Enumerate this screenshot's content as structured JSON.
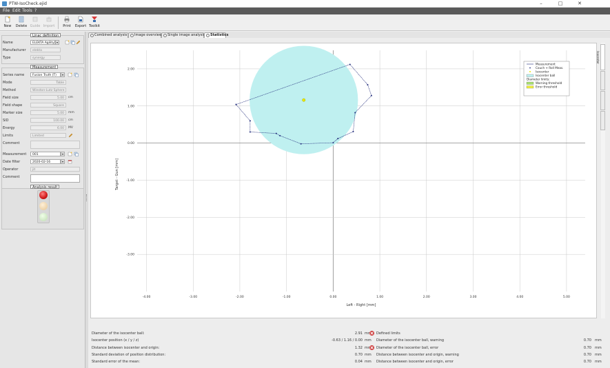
{
  "window": {
    "title": "PTW-IsoCheck.ejid"
  },
  "menu": [
    "File",
    "Edit",
    "Tools",
    "?"
  ],
  "toolbar": {
    "buttons": [
      {
        "label": "New",
        "icon": "new-file-icon",
        "enabled": true
      },
      {
        "label": "Delete",
        "icon": "delete-icon",
        "enabled": true
      },
      {
        "label": "Guide",
        "icon": "guide-icon",
        "enabled": false
      },
      {
        "label": "Import",
        "icon": "import-icon",
        "enabled": false
      },
      {
        "label": "Print",
        "icon": "print-icon",
        "enabled": true
      },
      {
        "label": "Export",
        "icon": "export-icon",
        "enabled": true
      },
      {
        "label": "Toolkit",
        "icon": "toolkit-icon",
        "enabled": true
      }
    ]
  },
  "linac": {
    "header": "Linac definition",
    "name_label": "Name",
    "name_value": "ELEKTA Agility",
    "manufacturer_label": "Manufacturer",
    "manufacturer_value": "elekta",
    "type_label": "Type",
    "type_value": "synergy"
  },
  "measurement": {
    "header": "Measurement",
    "fields": [
      {
        "label": "Series name",
        "value": "Fusion Truth (T)",
        "unit": "",
        "kind": "combo"
      },
      {
        "label": "Mode",
        "value": "Table",
        "unit": "",
        "kind": "ro"
      },
      {
        "label": "Method",
        "value": "Winston-Lutz Sphere",
        "unit": "",
        "kind": "ro"
      },
      {
        "label": "Field size",
        "value": "5.00",
        "unit": "cm",
        "kind": "ro"
      },
      {
        "label": "Field shape",
        "value": "Square",
        "unit": "",
        "kind": "ro"
      },
      {
        "label": "Marker size",
        "value": "5.00",
        "unit": "mm",
        "kind": "ro"
      },
      {
        "label": "SID",
        "value": "100.00",
        "unit": "cm",
        "kind": "ro"
      },
      {
        "label": "Energy",
        "value": "6.00",
        "unit": "MV",
        "kind": "ro"
      },
      {
        "label": "Limits",
        "value": "Limited",
        "unit": "",
        "kind": "ro"
      },
      {
        "label": "Comment",
        "value": "",
        "unit": "",
        "kind": "ro"
      }
    ],
    "measurement_label": "Measurement",
    "measurement_value": "001",
    "date_label": "Date filter",
    "date_value": "2020-02-16",
    "operator_label": "Operator",
    "operator_value": "jit",
    "comment_label": "Comment",
    "comment_value": ""
  },
  "analysis": {
    "header": "Analysis result"
  },
  "tabs": [
    {
      "label": "Combined analysis",
      "active": false
    },
    {
      "label": "Image overview",
      "active": false
    },
    {
      "label": "Single image analysis",
      "active": false
    },
    {
      "label": "Statistics",
      "active": true
    }
  ],
  "side_tabs": [
    "Isocenter",
    "",
    "",
    ""
  ],
  "chart_data": {
    "type": "scatter",
    "xlabel": "Left - Right [mm]",
    "ylabel": "Target - Gun [mm]",
    "xlim": [
      -4.2,
      5.4
    ],
    "ylim": [
      -4.0,
      2.5
    ],
    "xticks": [
      -4,
      -3,
      -2,
      -1,
      0,
      1,
      2,
      3,
      4,
      5
    ],
    "yticks": [
      2,
      1,
      0,
      -1,
      -2,
      -3
    ],
    "xtick_labels": [
      "-4.00",
      "-3.00",
      "-2.00",
      "-1.00",
      "0.00",
      "1.00",
      "2.00",
      "3.00",
      "4.00",
      "5.00"
    ],
    "ytick_labels": [
      "2.00",
      "1.00",
      "0.00",
      "-1.00",
      "-2.00",
      "-3.00"
    ],
    "grid": true,
    "legend_position": "top-right",
    "isocenter_ball": {
      "center": [
        -0.63,
        1.16
      ],
      "radius": 1.46,
      "color": "#bff0f0"
    },
    "isocenter": {
      "x": -0.63,
      "y": 1.16,
      "color": "#e8e800"
    },
    "series": [
      {
        "name": "Measurement",
        "color": "#1f2a7a",
        "x": [
          -2.08,
          0.36,
          0.74,
          0.82,
          0.47,
          0.43,
          0.1,
          0.0,
          -0.69,
          -1.14,
          -1.22,
          -1.78,
          -1.78,
          -2.08
        ],
        "y": [
          1.04,
          2.12,
          1.57,
          1.28,
          0.82,
          0.31,
          0.12,
          0.01,
          -0.02,
          0.2,
          0.26,
          0.3,
          0.6,
          1.04
        ]
      }
    ],
    "legend": {
      "items": [
        "Measurement",
        "Couch + Roll Meas.",
        "Isocenter",
        "Isocenter ball",
        "Diameter limits:",
        "Warning threshold",
        "Error threshold"
      ],
      "colors": {
        "measurement": "#1f2a7a",
        "ball": "#bff0f0",
        "warning": "#a8e070",
        "error": "#f0f040"
      }
    }
  },
  "results": [
    {
      "label": "Diameter of the isocenter ball:",
      "value": "2.91",
      "unit": "mm",
      "status": "error",
      "rlabel": "Defined limits",
      "rvalue": "",
      "runit": ""
    },
    {
      "label": "Isocenter position (x / y / z)",
      "value": "-0.63 / 1.16 / 0.00",
      "unit": "mm",
      "status": "",
      "rlabel": "Diameter of the isocenter ball, warning",
      "rvalue": "0.70",
      "runit": "mm"
    },
    {
      "label": "Distance between isocenter and origin:",
      "value": "1.32",
      "unit": "mm",
      "status": "error",
      "rlabel": "Diameter of the isocenter ball, error",
      "rvalue": "0.70",
      "runit": "mm"
    },
    {
      "label": "Standard deviation of position distribution:",
      "value": "0.70",
      "unit": "mm",
      "status": "",
      "rlabel": "Distance between isocenter and origin, warning",
      "rvalue": "0.70",
      "runit": "mm"
    },
    {
      "label": "Standard error of the mean:",
      "value": "0.04",
      "unit": "mm",
      "status": "",
      "rlabel": "Distance between isocenter and origin, error",
      "rvalue": "0.70",
      "runit": "mm"
    }
  ]
}
